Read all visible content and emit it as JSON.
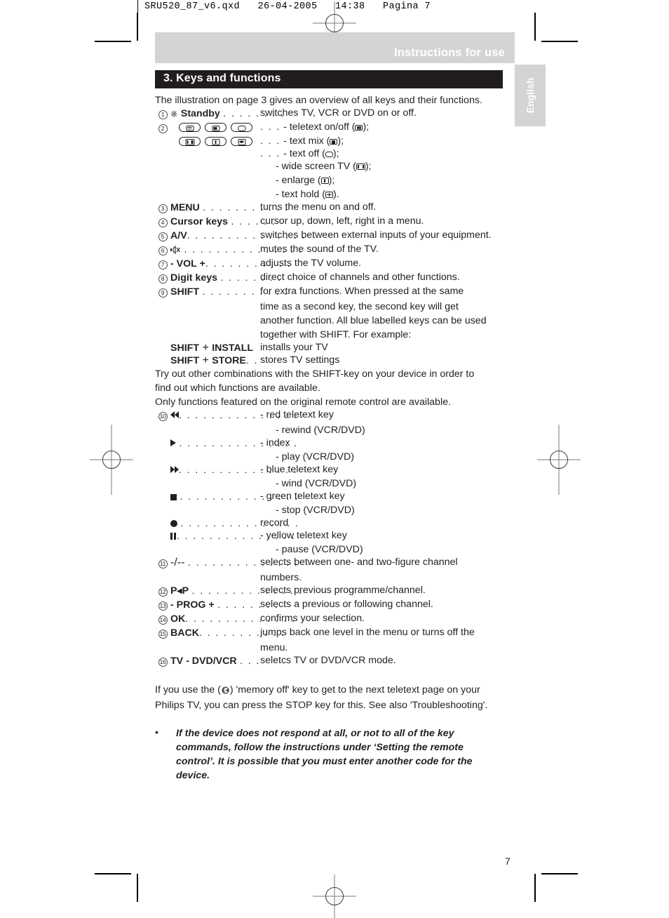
{
  "film_header": {
    "text": "SRU520_87_v6.qxd   26-04-2005   14:38   Pagina 7"
  },
  "header": {
    "running_head": "Instructions for use",
    "section_title": "3. Keys and functions",
    "language_tab": "English"
  },
  "intro": "The illustration on page 3 gives an overview of all keys and their functions.",
  "items": [
    {
      "num": "1",
      "icon": "power-standby-icon",
      "key": "Standby",
      "leader": ". . . . . . . .",
      "desc": "switches TV, VCR or DVD on or off."
    },
    {
      "num": "2",
      "key": "",
      "leader": ". . .",
      "lines": [
        "- teletext on/off (",
        "- text mix (",
        "- text off (",
        "- wide screen TV (",
        "- enlarge (",
        "- text hold ("
      ],
      "tails": [
        ");",
        ");",
        ");",
        ");",
        ");",
        ")."
      ]
    },
    {
      "num": "3",
      "key": "MENU",
      "leader": ". . . . . . . . . . .",
      "desc": "turns the menu on and off."
    },
    {
      "num": "4",
      "key": "Cursor keys",
      "leader": ". . . . . .",
      "desc": "cursor up, down, left, right in a menu."
    },
    {
      "num": "5",
      "key": "A/V",
      "leader": ". . . . . . . . . . . . . . .",
      "desc": "switches between external inputs of your equipment."
    },
    {
      "num": "6",
      "icon": "mute-icon",
      "key": "",
      "leader": ". . . . . . . . . . . . . . .",
      "desc": "mutes the sound of the TV."
    },
    {
      "num": "7",
      "key": "- VOL +",
      "leader": ". . . . . . . . . . .",
      "desc": "adjusts the TV volume."
    },
    {
      "num": "8",
      "key": "Digit keys",
      "leader": ". . . . . . . .",
      "desc": "direct choice of channels and other functions."
    },
    {
      "num": "9",
      "key": "SHIFT",
      "leader": ". . . . . . . . . . .",
      "desc": "for extra functions. When pressed at the same",
      "cont": [
        "time as a second key, the second key will get",
        "another function. All blue labelled keys can be used",
        "together with SHIFT. For example:"
      ]
    }
  ],
  "shift_examples": [
    {
      "key1": "SHIFT",
      "plus": "+",
      "key2": "INSTALL",
      "leader": "",
      "desc": "installs your TV"
    },
    {
      "key1": "SHIFT",
      "plus": "+",
      "key2": "STORE",
      "leader": ". .",
      "desc": "stores TV settings"
    }
  ],
  "shift_notes": [
    "Try out other combinations with the SHIFT-key on your device in order to",
    "find out which functions are available.",
    "Only functions featured on the original remote control are available."
  ],
  "transport": {
    "num": "10",
    "rows": [
      {
        "icon": "rewind-icon",
        "leader": ". . . . . . . . . . . . . . .",
        "desc": "- red teletext key",
        "sub": "- rewind (VCR/DVD)"
      },
      {
        "icon": "play-icon",
        "leader": ". . . . . . . . . . . . . . .",
        "desc": "- index",
        "sub": "- play (VCR/DVD)"
      },
      {
        "icon": "wind-icon",
        "leader": ". . . . . . . . . . . . . . .",
        "desc": "- blue teletext key",
        "sub": "- wind (VCR/DVD)"
      },
      {
        "icon": "stop-icon",
        "leader": ". . . . . . . . . . . . . . .",
        "desc": "- green teletext key",
        "sub": "- stop (VCR/DVD)"
      },
      {
        "icon": "record-icon",
        "leader": ". . . . . . . . . . . . . . .",
        "desc": "record",
        "sub": ""
      },
      {
        "icon": "pause-icon",
        "leader": ". . . . . . . . . . . . . . .",
        "desc": "- yellow teletext key",
        "sub": "- pause (VCR/DVD)"
      }
    ]
  },
  "items2": [
    {
      "num": "11",
      "key": "-/--",
      "leader": ". . . . . . . . . . . . . .",
      "desc": "selects between one- and two-figure channel",
      "cont": [
        "numbers."
      ]
    },
    {
      "num": "12",
      "key": "P◂P",
      "leader": ". . . . . . . . . . . . . .",
      "desc": "selects previous programme/channel."
    },
    {
      "num": "13",
      "key": "- PROG +",
      "leader": ". . . . . . . .",
      "desc": "selects a previous or following channel."
    },
    {
      "num": "14",
      "key": "OK",
      "leader": ". . . . . . . . . . . . . .",
      "desc": "confirms your selection."
    },
    {
      "num": "15",
      "key": "BACK",
      "leader": ". . . . . . . . . . .",
      "desc": "jumps back one level in the menu or turns off the",
      "cont": [
        "menu."
      ]
    },
    {
      "num": "16",
      "key": "TV - DVD/VCR",
      "leader": ". . .",
      "desc": "seletcs TV or DVD/VCR mode."
    }
  ],
  "closing": {
    "line1_a": "If you use the (",
    "line1_icon": "memory-off-icon",
    "line1_b": ") 'memory off' key to get to the next teletext page on your",
    "line2": "Philips TV, you can press the STOP key for this. See also 'Troubleshooting'."
  },
  "warning": {
    "bullet": "•",
    "lines": [
      "If the device does not respond at all, or not to all of the key",
      "commands, follow the instructions under ‘Setting the remote",
      "control’. It is possible that you must enter another code for the",
      "device."
    ]
  },
  "page_number": "7",
  "colors": {
    "running_head_bg": "#d4d4d4",
    "section_title_bg": "#211d1e",
    "text": "#231f20"
  }
}
